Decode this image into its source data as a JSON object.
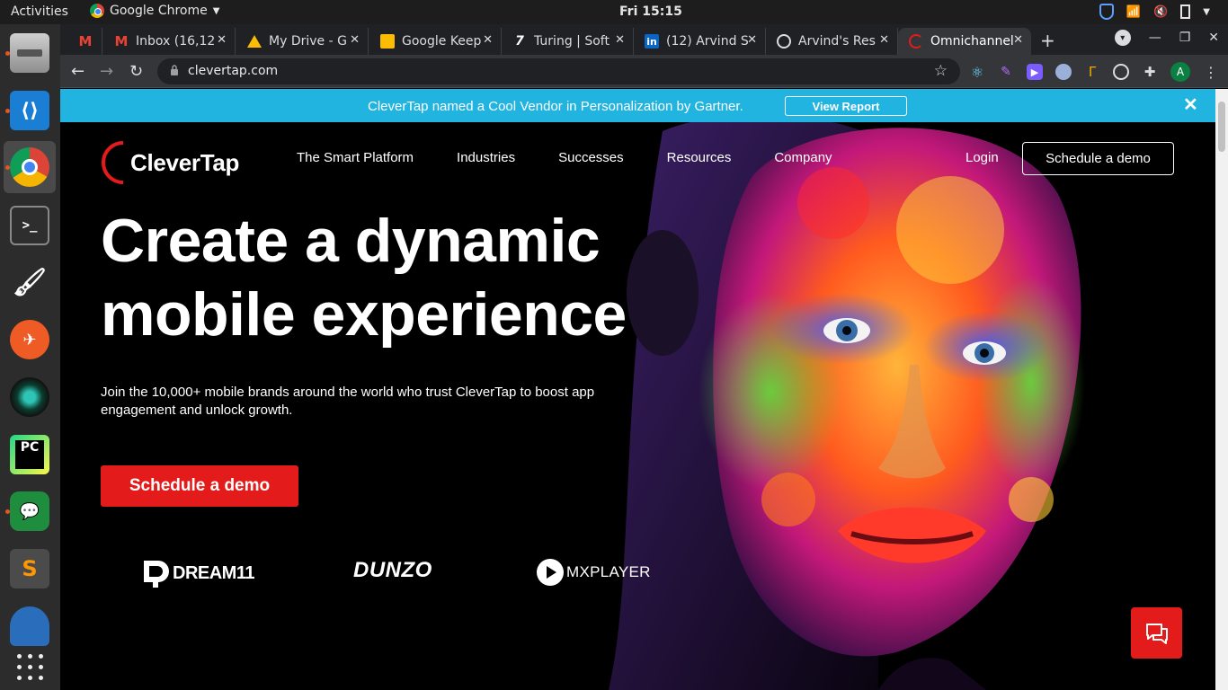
{
  "system": {
    "activities": "Activities",
    "app_name": "Google Chrome",
    "clock": "Fri 15:15"
  },
  "browser": {
    "tabs": [
      {
        "title": "",
        "icon": "gmail-icon"
      },
      {
        "title": "Inbox (16,12",
        "icon": "gmail-icon"
      },
      {
        "title": "My Drive - G",
        "icon": "drive-icon"
      },
      {
        "title": "Google Keep",
        "icon": "keep-icon"
      },
      {
        "title": "Turing | Soft",
        "icon": "turing-icon"
      },
      {
        "title": "(12) Arvind S",
        "icon": "linkedin-icon"
      },
      {
        "title": "Arvind's Res",
        "icon": "globe-icon"
      },
      {
        "title": "Omnichannel",
        "icon": "clevertap-icon",
        "active": true
      }
    ],
    "url": "clevertap.com",
    "profile_initial": "A"
  },
  "banner": {
    "message": "CleverTap named a Cool Vendor in Personalization by Gartner.",
    "button": "View Report",
    "close": "✕"
  },
  "site": {
    "logo_text": "CleverTap",
    "nav": [
      "The Smart Platform",
      "Industries",
      "Successes",
      "Resources",
      "Company"
    ],
    "login": "Login",
    "demo_top": "Schedule a demo",
    "headline_line1": "Create a dynamic",
    "headline_line2": "mobile experience",
    "subtext": "Join the 10,000+ mobile brands around the world who trust CleverTap to boost app engagement and unlock growth.",
    "demo_main": "Schedule a demo",
    "brands": [
      "DREAM11",
      "DUNZO",
      "MXPLAYER"
    ]
  },
  "colors": {
    "banner": "#22b4e0",
    "accent_red": "#e41b1b"
  }
}
